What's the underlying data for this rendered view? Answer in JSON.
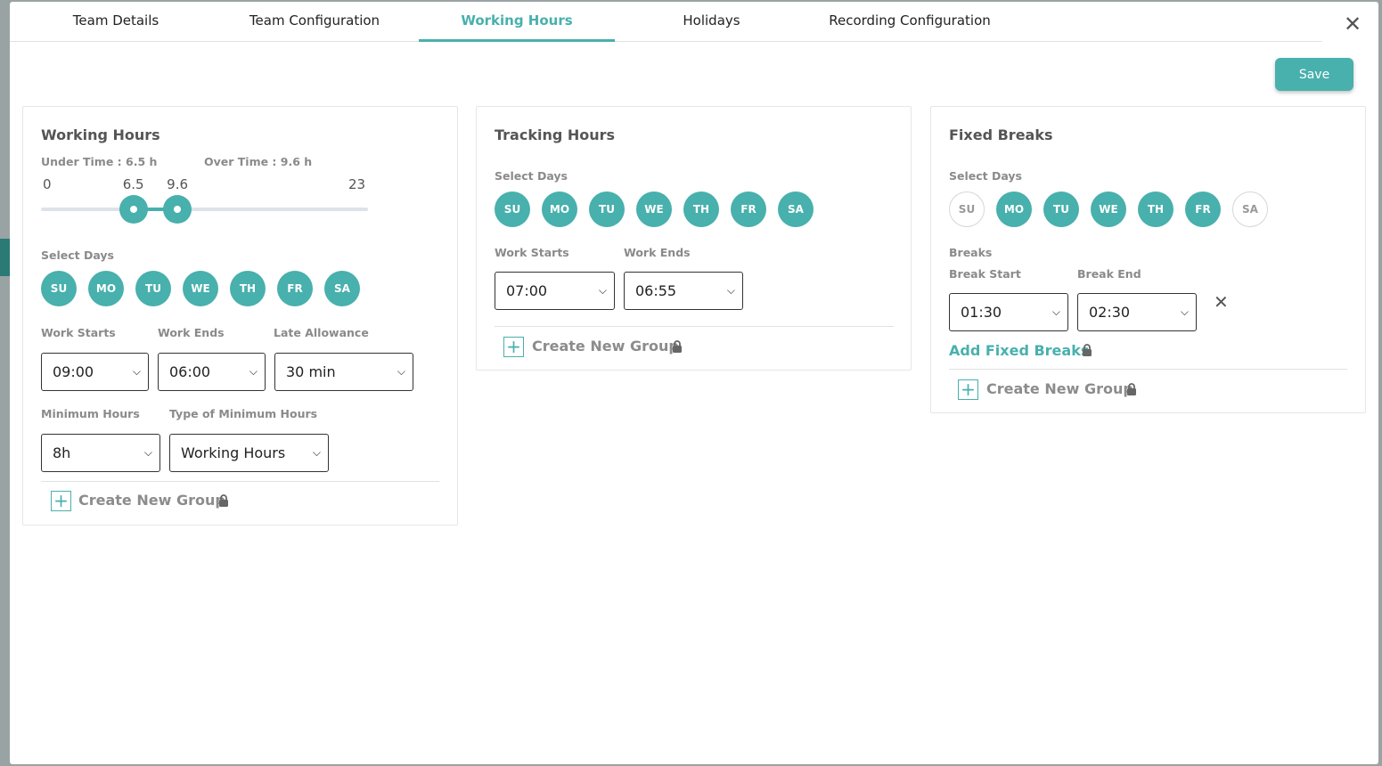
{
  "tabs": [
    {
      "label": "Team Details"
    },
    {
      "label": "Team Configuration"
    },
    {
      "label": "Working Hours"
    },
    {
      "label": "Holidays"
    },
    {
      "label": "Recording Configuration"
    }
  ],
  "active_tab": "Working Hours",
  "close_glyph": "✕",
  "save_label": "Save",
  "colors": {
    "accent": "#48b0ad"
  },
  "working_hours": {
    "title": "Working Hours",
    "under_time": "Under Time : 6.5 h",
    "over_time": "Over Time : 9.6 h",
    "slider": {
      "min": 0,
      "max": 23,
      "low": 6.5,
      "high": 9.6,
      "min_label": "0",
      "max_label": "23",
      "low_label": "6.5",
      "high_label": "9.6"
    },
    "select_days_label": "Select Days",
    "days": [
      {
        "label": "SU",
        "selected": true
      },
      {
        "label": "MO",
        "selected": true
      },
      {
        "label": "TU",
        "selected": true
      },
      {
        "label": "WE",
        "selected": true
      },
      {
        "label": "TH",
        "selected": true
      },
      {
        "label": "FR",
        "selected": true
      },
      {
        "label": "SA",
        "selected": true
      }
    ],
    "work_starts_label": "Work Starts",
    "work_starts": "09:00",
    "work_ends_label": "Work Ends",
    "work_ends": "06:00",
    "late_allowance_label": "Late Allowance",
    "late_allowance": "30 min",
    "minimum_hours_label": "Minimum Hours",
    "minimum_hours": "8h",
    "type_min_label": "Type of Minimum Hours",
    "type_min": "Working Hours",
    "create_group": "Create New Group"
  },
  "tracking_hours": {
    "title": "Tracking Hours",
    "select_days_label": "Select Days",
    "days": [
      {
        "label": "SU",
        "selected": true
      },
      {
        "label": "MO",
        "selected": true
      },
      {
        "label": "TU",
        "selected": true
      },
      {
        "label": "WE",
        "selected": true
      },
      {
        "label": "TH",
        "selected": true
      },
      {
        "label": "FR",
        "selected": true
      },
      {
        "label": "SA",
        "selected": true
      }
    ],
    "work_starts_label": "Work Starts",
    "work_starts": "07:00",
    "work_ends_label": "Work Ends",
    "work_ends": "06:55",
    "create_group": "Create New Group"
  },
  "fixed_breaks": {
    "title": "Fixed Breaks",
    "select_days_label": "Select Days",
    "days": [
      {
        "label": "SU",
        "selected": false
      },
      {
        "label": "MO",
        "selected": true
      },
      {
        "label": "TU",
        "selected": true
      },
      {
        "label": "WE",
        "selected": true
      },
      {
        "label": "TH",
        "selected": true
      },
      {
        "label": "FR",
        "selected": true
      },
      {
        "label": "SA",
        "selected": false
      }
    ],
    "breaks_label": "Breaks",
    "break_start_label": "Break Start",
    "break_start": "01:30",
    "break_end_label": "Break End",
    "break_end": "02:30",
    "add_fixed_breaks": "Add Fixed Breaks",
    "create_group": "Create New Group"
  }
}
